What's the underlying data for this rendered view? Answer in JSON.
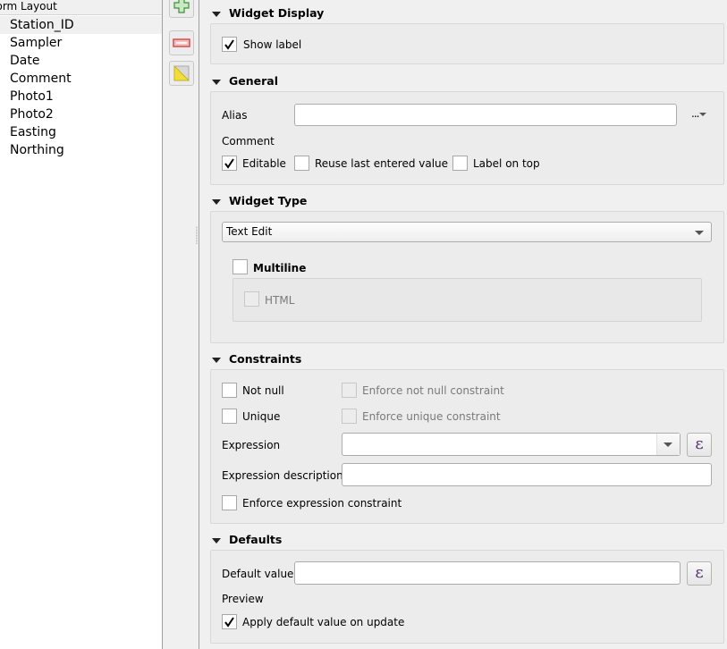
{
  "tree": {
    "header": "Form Layout",
    "items": [
      {
        "label": "Station_ID",
        "selected": true
      },
      {
        "label": "Sampler",
        "selected": false
      },
      {
        "label": "Date",
        "selected": false
      },
      {
        "label": "Comment",
        "selected": false
      },
      {
        "label": "Photo1",
        "selected": false
      },
      {
        "label": "Photo2",
        "selected": false
      },
      {
        "label": "Easting",
        "selected": false
      },
      {
        "label": "Northing",
        "selected": false
      }
    ]
  },
  "toolbar": {
    "add_icon": "plus-icon",
    "remove_icon": "minus-icon",
    "edit_icon": "edit-triangle-icon"
  },
  "widget_display": {
    "title": "Widget Display",
    "show_label": {
      "label": "Show label",
      "checked": true
    }
  },
  "general": {
    "title": "General",
    "alias_label": "Alias",
    "alias_value": "",
    "more_button": "...",
    "comment_label": "Comment",
    "editable": {
      "label": "Editable",
      "checked": true
    },
    "reuse_last": {
      "label": "Reuse last entered value",
      "checked": false
    },
    "label_on_top": {
      "label": "Label on top",
      "checked": false
    }
  },
  "widget_type": {
    "title": "Widget Type",
    "selected": "Text Edit",
    "multiline": {
      "label": "Multiline",
      "checked": false
    },
    "html": {
      "label": "HTML",
      "checked": false,
      "enabled": false
    }
  },
  "constraints": {
    "title": "Constraints",
    "not_null": {
      "label": "Not null",
      "checked": false
    },
    "enforce_not_null": {
      "label": "Enforce not null constraint",
      "checked": false,
      "enabled": false
    },
    "unique": {
      "label": "Unique",
      "checked": false
    },
    "enforce_unique": {
      "label": "Enforce unique constraint",
      "checked": false,
      "enabled": false
    },
    "expression_label": "Expression",
    "expression_value": "",
    "expression_desc_label": "Expression description",
    "expression_desc_value": "",
    "enforce_expression": {
      "label": "Enforce expression constraint",
      "checked": false
    },
    "epsilon_glyph": "ε"
  },
  "defaults": {
    "title": "Defaults",
    "default_value_label": "Default value",
    "default_value": "",
    "preview_label": "Preview",
    "apply_on_update": {
      "label": "Apply default value on update",
      "checked": true
    },
    "epsilon_glyph": "ε"
  }
}
